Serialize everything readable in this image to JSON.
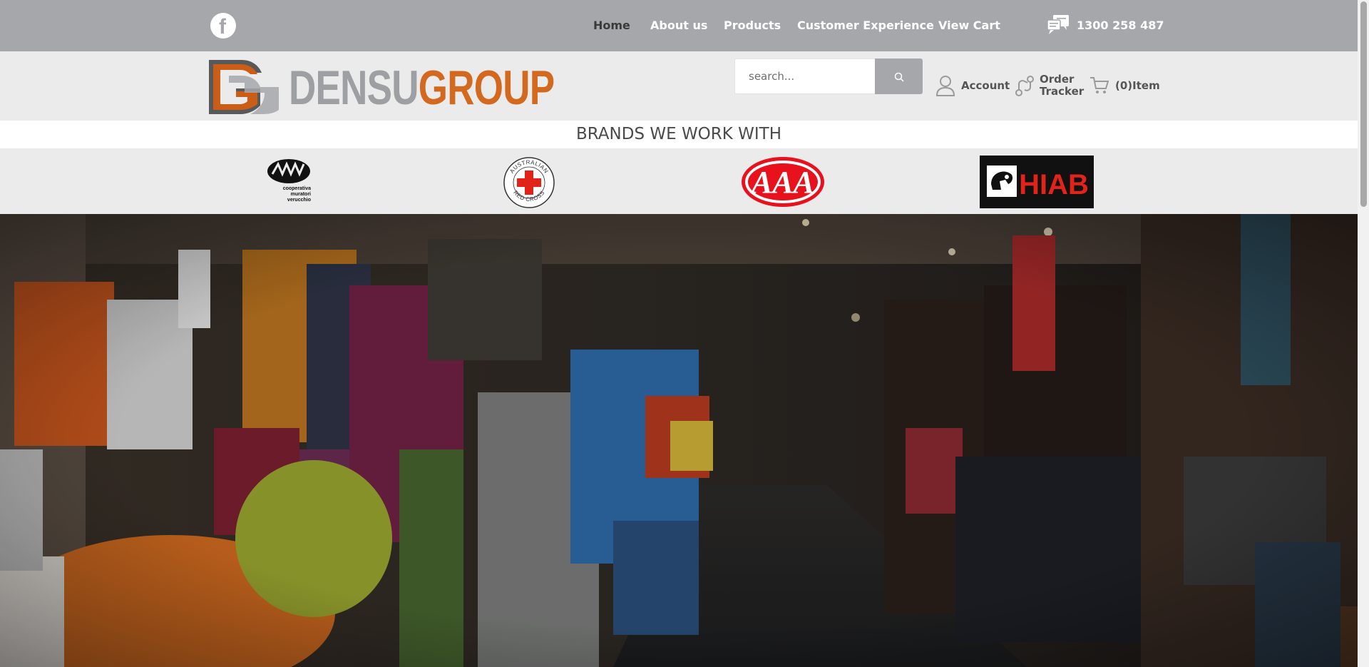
{
  "topbar": {
    "facebook_icon": "facebook-icon",
    "nav": [
      {
        "label": "Home",
        "active": true
      },
      {
        "label": "About us",
        "active": false
      },
      {
        "label": "Products",
        "active": false
      },
      {
        "label": "Customer Experience",
        "active": false
      },
      {
        "label": "View Cart",
        "active": false
      }
    ],
    "phone_icon": "chat-phone-icon",
    "phone": "1300 258 487"
  },
  "header": {
    "logo": {
      "part1": "DENSU",
      "part2": "GROUP"
    },
    "search": {
      "placeholder": "search..."
    },
    "account_label": "Account",
    "order_tracker_line1": "Order",
    "order_tracker_line2": "Tracker",
    "cart_label": "(0)Item"
  },
  "brands": {
    "title": "BRANDS WE WORK WITH",
    "items": [
      {
        "name": "CMV",
        "caption1": "cooperativa",
        "caption2": "muratori",
        "caption3": "verucchio"
      },
      {
        "name": "Australian Red Cross",
        "ring_top": "AUSTRALIAN",
        "ring_bottom": "RED CROSS"
      },
      {
        "name": "AAA",
        "text": "AAA"
      },
      {
        "name": "HIAB",
        "text": "HIAB"
      }
    ]
  },
  "colors": {
    "topbar": "#a6a7ab",
    "header": "#ebebeb",
    "brand_orange": "#d2691e",
    "brand_grey": "#9d9fa3"
  }
}
